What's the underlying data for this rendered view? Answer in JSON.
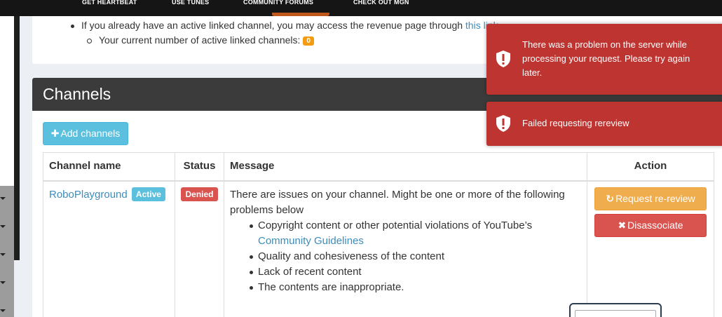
{
  "nav": {
    "items": [
      "GET HEARTBEAT",
      "USE TUNES",
      "COMMUNITY FORUMS",
      "CHECK OUT MGN"
    ]
  },
  "info": {
    "line1_prefix": "If you already have an active linked channel, you may access the revenue page through ",
    "line1_link": "this link",
    "line2_prefix": "Your current number of active linked channels: ",
    "active_count": "0"
  },
  "channels": {
    "title": "Channels",
    "add_button": "Add channels",
    "columns": {
      "name": "Channel name",
      "status": "Status",
      "message": "Message",
      "action": "Action"
    },
    "rows": [
      {
        "name": "RoboPlayground",
        "name_badge": "Active",
        "status": "Denied",
        "message_intro": "There are issues on your channel. Might be one or more of the following problems below",
        "issue1_prefix": "Copyright content or other potential violations of YouTube’s ",
        "issue1_link": "Community Guidelines",
        "issue2": "Quality and cohesiveness of the content",
        "issue3": "Lack of recent content",
        "issue4": "The contents are inappropriate.",
        "rereview_button": "Request re-review",
        "disassociate_button": "Disassociate"
      }
    ]
  },
  "toasts": {
    "error1": "There was a problem on the server while processing your request. Please try again later.",
    "error2": "Failed requesting rereview"
  },
  "colors": {
    "nav_bg": "#151515",
    "header_bg": "#3b3b3b",
    "info_btn": "#5bc0de",
    "warning_btn": "#f0ad4e",
    "danger_btn": "#d9534f",
    "toast_bg": "#bd3430",
    "link": "#3c8dbc",
    "count_badge": "#f39c12"
  },
  "icons": {
    "add": "plus-icon",
    "rereview": "refresh-icon",
    "disassociate": "close-icon",
    "toast": "shield-exclamation-icon"
  }
}
